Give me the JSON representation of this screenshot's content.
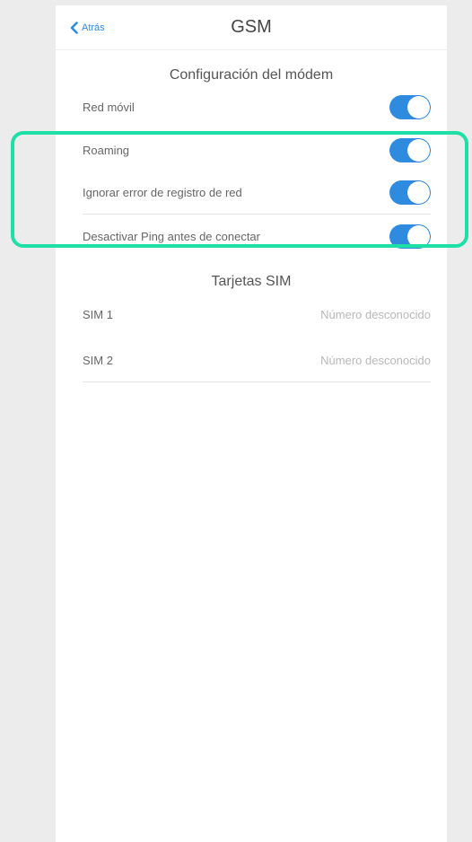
{
  "header": {
    "back_label": "Atrás",
    "title": "GSM"
  },
  "modem": {
    "section_title": "Configuración del módem",
    "items": [
      {
        "label": "Red móvil",
        "enabled": true
      },
      {
        "label": "Roaming",
        "enabled": true
      },
      {
        "label": "Ignorar error de registro de red",
        "enabled": true
      },
      {
        "label": "Desactivar Ping antes de conectar",
        "enabled": true
      }
    ]
  },
  "sim": {
    "section_title": "Tarjetas SIM",
    "items": [
      {
        "label": "SIM 1",
        "value": "Número desconocido"
      },
      {
        "label": "SIM 2",
        "value": "Número desconocido"
      }
    ]
  },
  "colors": {
    "accent": "#2f8be0",
    "highlight": "#1ee0a6",
    "background": "#ececec"
  }
}
